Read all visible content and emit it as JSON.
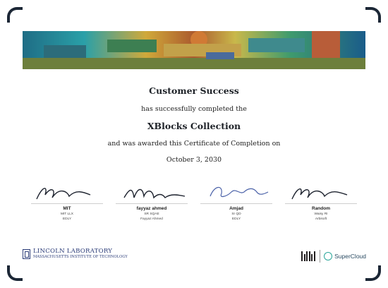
{
  "certificate": {
    "recipient": "Customer Success",
    "completed_text": "has successfully completed the",
    "course": "XBlocks Collection",
    "awarded_text": "and was awarded this Certificate of Completion on",
    "date": "October 3, 2030"
  },
  "signatories": [
    {
      "name": "MIT",
      "role": "MIT LLX",
      "org": "EDLY"
    },
    {
      "name": "fayyaz ahmed",
      "role": "SR SQAE",
      "org": "Fayyaz Ahmed"
    },
    {
      "name": "Amjad",
      "role": "Sr QD",
      "org": "EDLY"
    },
    {
      "name": "Random",
      "role": "Waisy RI",
      "org": "Arbisoft"
    }
  ],
  "footer": {
    "lincoln_title": "LINCOLN LABORATORY",
    "lincoln_subtitle": "MASSACHUSETTS INSTITUTE OF TECHNOLOGY",
    "supercloud": "SuperCloud"
  },
  "colors": {
    "frame": "#1c2736",
    "lincoln": "#2b3c78",
    "supercloud": "#2aa59a"
  }
}
